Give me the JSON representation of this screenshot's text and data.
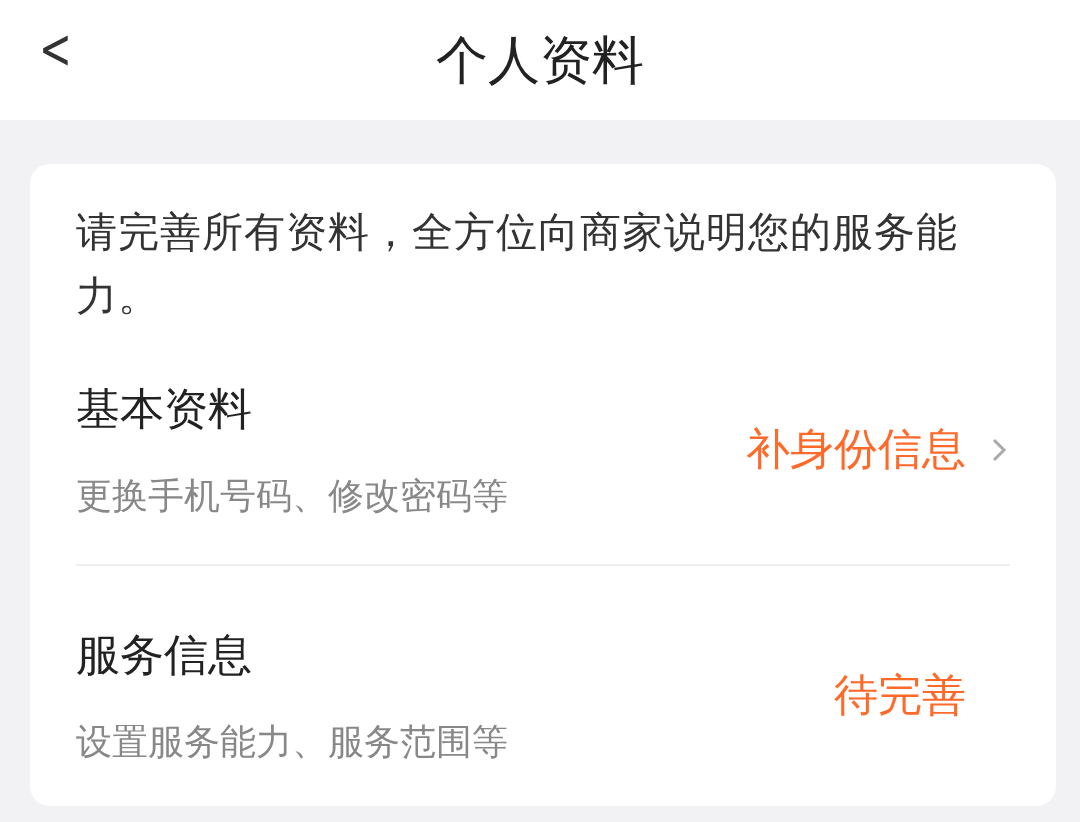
{
  "header": {
    "back": "<",
    "title": "个人资料"
  },
  "card": {
    "intro": "请完善所有资料，全方位向商家说明您的服务能力。",
    "rows": [
      {
        "title": "基本资料",
        "subtitle": "更换手机号码、修改密码等",
        "status": "补身份信息",
        "chevron": true
      },
      {
        "title": "服务信息",
        "subtitle": "设置服务能力、服务范围等",
        "status": "待完善",
        "chevron": false
      }
    ]
  }
}
